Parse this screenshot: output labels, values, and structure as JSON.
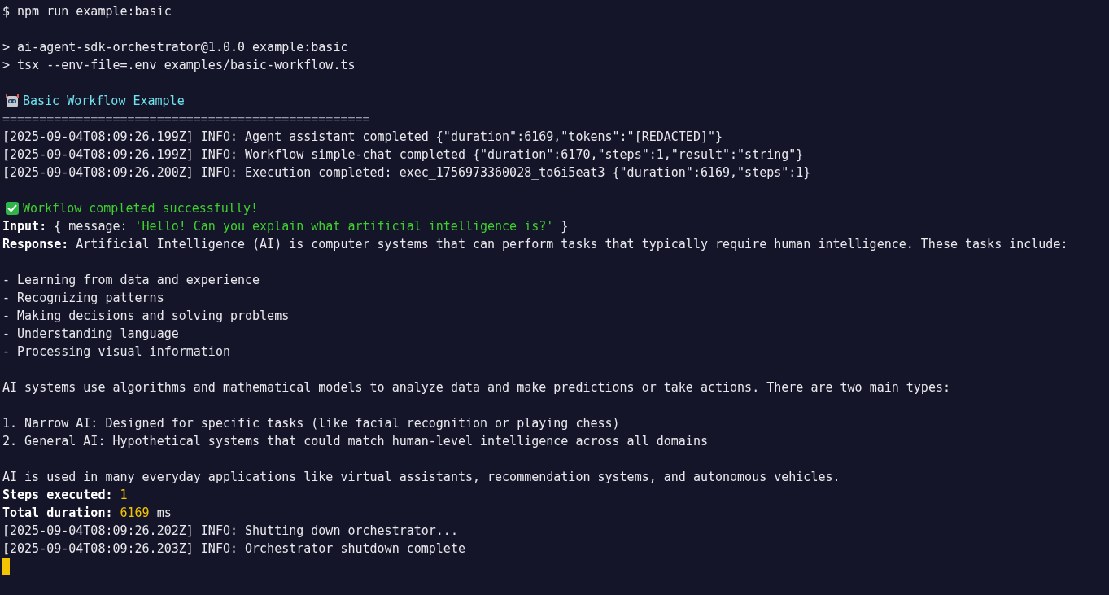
{
  "terminal": {
    "lines": [
      {
        "kind": "plain",
        "text": "$ npm run example:basic"
      },
      {
        "kind": "blank"
      },
      {
        "kind": "plain",
        "text": "> ai-agent-sdk-orchestrator@1.0.0 example:basic"
      },
      {
        "kind": "plain",
        "text": "> tsx --env-file=.env examples/basic-workflow.ts"
      },
      {
        "kind": "blank"
      },
      {
        "kind": "heading",
        "text": "Basic Workflow Example"
      },
      {
        "kind": "rule",
        "text": "=================================================="
      },
      {
        "kind": "plain",
        "text": "[2025-09-04T08:09:26.199Z] INFO: Agent assistant completed {\"duration\":6169,\"tokens\":\"[REDACTED]\"}"
      },
      {
        "kind": "plain",
        "text": "[2025-09-04T08:09:26.199Z] INFO: Workflow simple-chat completed {\"duration\":6170,\"steps\":1,\"result\":\"string\"}"
      },
      {
        "kind": "plain",
        "text": "[2025-09-04T08:09:26.200Z] INFO: Execution completed: exec_1756973360028_to6i5eat3 {\"duration\":6169,\"steps\":1}"
      },
      {
        "kind": "blank"
      },
      {
        "kind": "success",
        "text": "Workflow completed successfully!"
      },
      {
        "kind": "input",
        "label": "Input:",
        "prefix": "{ message:",
        "quoted": "'Hello! Can you explain what artificial intelligence is?'",
        "suffix": "}"
      },
      {
        "kind": "labeled",
        "label": "Response:",
        "text": "Artificial Intelligence (AI) is computer systems that can perform tasks that typically require human intelligence. These tasks include:"
      },
      {
        "kind": "blank"
      },
      {
        "kind": "plain",
        "text": "- Learning from data and experience"
      },
      {
        "kind": "plain",
        "text": "- Recognizing patterns"
      },
      {
        "kind": "plain",
        "text": "- Making decisions and solving problems"
      },
      {
        "kind": "plain",
        "text": "- Understanding language"
      },
      {
        "kind": "plain",
        "text": "- Processing visual information"
      },
      {
        "kind": "blank"
      },
      {
        "kind": "plain",
        "text": "AI systems use algorithms and mathematical models to analyze data and make predictions or take actions. There are two main types:"
      },
      {
        "kind": "blank"
      },
      {
        "kind": "plain",
        "text": "1. Narrow AI: Designed for specific tasks (like facial recognition or playing chess)"
      },
      {
        "kind": "plain",
        "text": "2. General AI: Hypothetical systems that could match human-level intelligence across all domains"
      },
      {
        "kind": "blank"
      },
      {
        "kind": "plain",
        "text": "AI is used in many everyday applications like virtual assistants, recommendation systems, and autonomous vehicles."
      },
      {
        "kind": "stat",
        "label": "Steps executed:",
        "value": "1"
      },
      {
        "kind": "stat",
        "label": "Total duration:",
        "value": "6169",
        "unit": "ms"
      },
      {
        "kind": "plain",
        "text": "[2025-09-04T08:09:26.202Z] INFO: Shutting down orchestrator..."
      },
      {
        "kind": "plain",
        "text": "[2025-09-04T08:09:26.203Z] INFO: Orchestrator shutdown complete"
      },
      {
        "kind": "cursor"
      }
    ]
  }
}
